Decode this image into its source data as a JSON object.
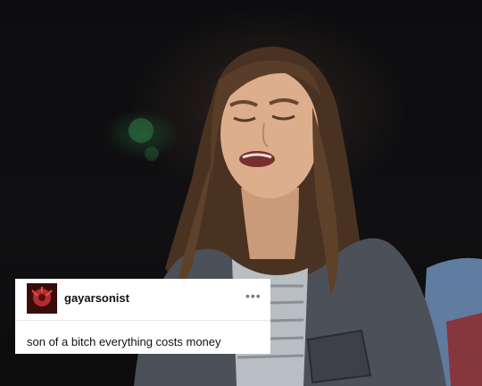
{
  "post": {
    "username": "gayarsonist",
    "text": "son of a bitch everything costs money",
    "avatar_icon": "avatar-image",
    "more_icon": "more-options-icon"
  },
  "colors": {
    "card_background": "#ffffff",
    "username": "#111111",
    "body_text": "#111111",
    "more_icon": "#777777"
  }
}
